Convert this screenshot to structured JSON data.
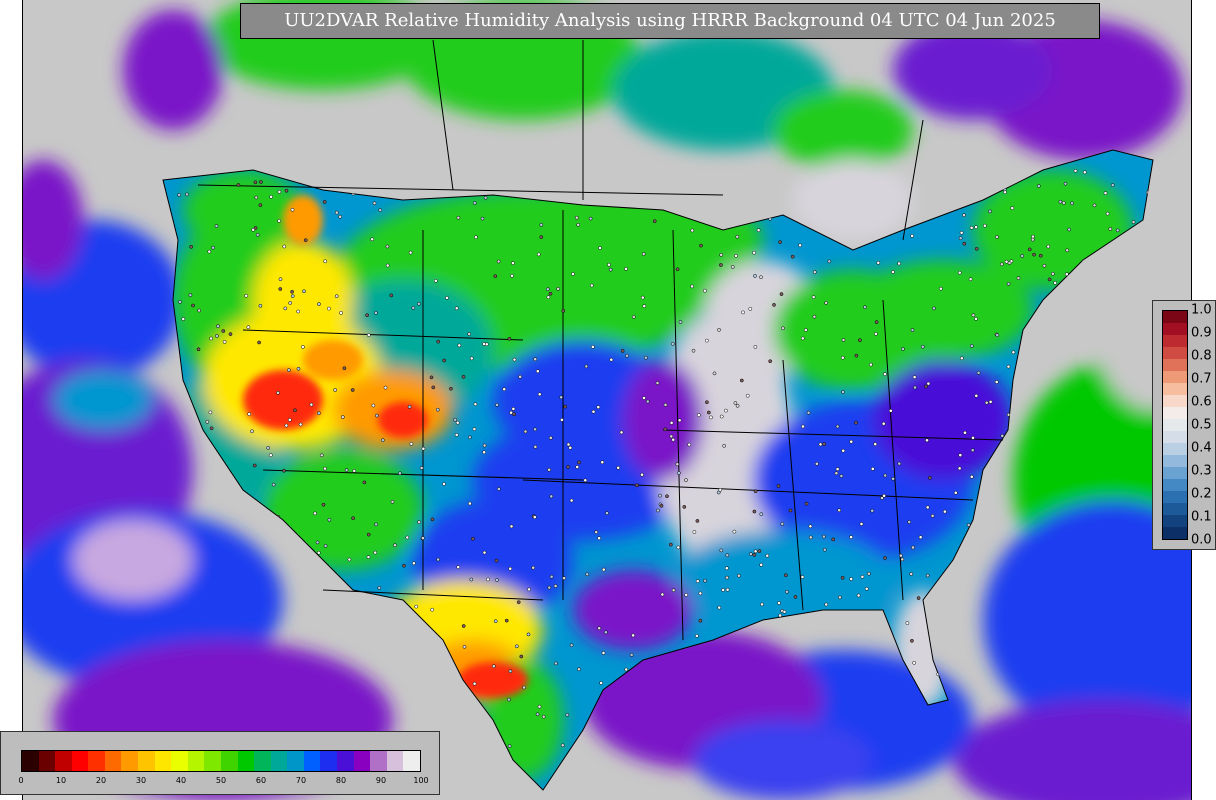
{
  "title": "UU2DVAR Relative Humidity Analysis using HRRR Background 04 UTC 04 Jun 2025",
  "colorbar_rh": {
    "tick_labels": [
      "0",
      "10",
      "20",
      "30",
      "40",
      "50",
      "60",
      "70",
      "80",
      "90",
      "100"
    ],
    "colors": [
      "#2a0000",
      "#6b0000",
      "#c00000",
      "#ff0000",
      "#ff3000",
      "#ff6a00",
      "#ff9a00",
      "#ffc400",
      "#ffe600",
      "#eaff00",
      "#b5f500",
      "#7fe800",
      "#3fd400",
      "#00c800",
      "#00b55a",
      "#00a89a",
      "#0096c8",
      "#0060ff",
      "#1e2ef0",
      "#4a10d8",
      "#8a00c0",
      "#b070c8",
      "#d7c0dc",
      "#eeeeee"
    ]
  },
  "colorbar_increment": {
    "tick_labels": [
      "0.0",
      "0.1",
      "0.2",
      "0.3",
      "0.4",
      "0.5",
      "0.6",
      "0.7",
      "0.8",
      "0.9",
      "1.0"
    ],
    "colors": [
      "#0b2f66",
      "#12437f",
      "#1d5a99",
      "#2b71b1",
      "#4589c4",
      "#6aa2d1",
      "#93b9dc",
      "#b8cfe4",
      "#d5dee8",
      "#e6e9ec",
      "#f3ece8",
      "#f8d8c8",
      "#f6bd9e",
      "#ee9a76",
      "#e0725a",
      "#d04c42",
      "#bd2a30",
      "#a30f22",
      "#7a0616"
    ]
  },
  "map_colors": {
    "ocean": "#c8c8c8",
    "dry_red": "#ff2a0a",
    "orange": "#ff9a00",
    "yellow": "#ffe800",
    "green": "#20cc1a",
    "teal": "#00a89a",
    "cyan_blue": "#0096d0",
    "blue": "#1c3cf0",
    "purple": "#7a14c8",
    "light_gray": "#d8d4dc"
  }
}
